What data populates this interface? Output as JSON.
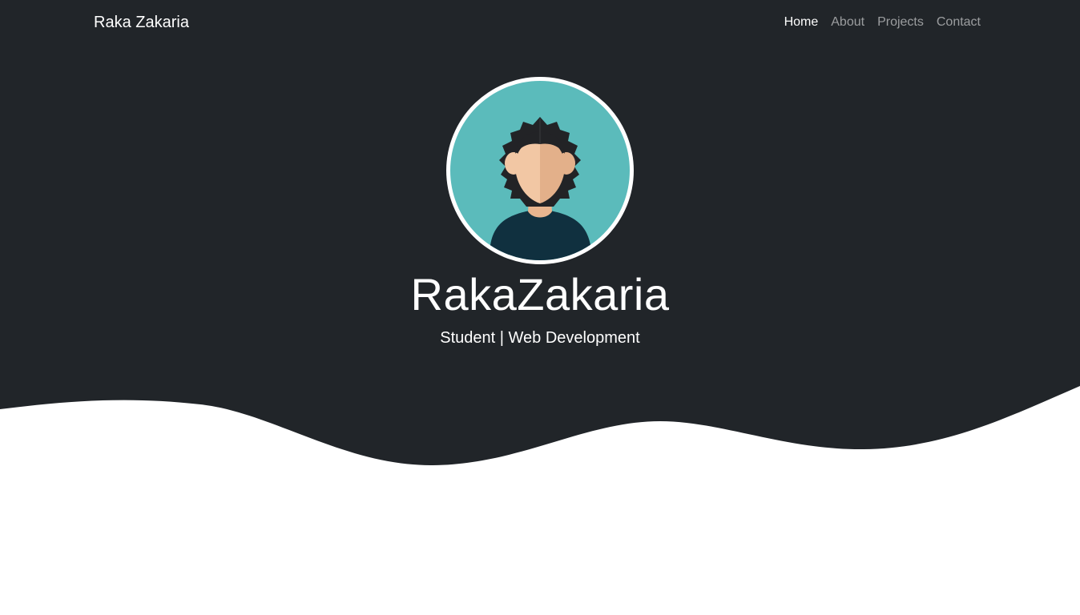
{
  "navbar": {
    "brand": "Raka Zakaria",
    "links": [
      {
        "label": "Home",
        "active": true
      },
      {
        "label": "About",
        "active": false
      },
      {
        "label": "Projects",
        "active": false
      },
      {
        "label": "Contact",
        "active": false
      }
    ]
  },
  "hero": {
    "avatar_icon": "male-avatar-icon",
    "name": "RakaZakaria",
    "subtitle": "Student | Web Development"
  },
  "colors": {
    "hero_background": "#212529",
    "page_background": "#ffffff",
    "avatar_background": "#5bbbbb",
    "avatar_ring": "#ffffff",
    "nav_active": "#ffffff",
    "nav_inactive": "#9a9c9e"
  }
}
